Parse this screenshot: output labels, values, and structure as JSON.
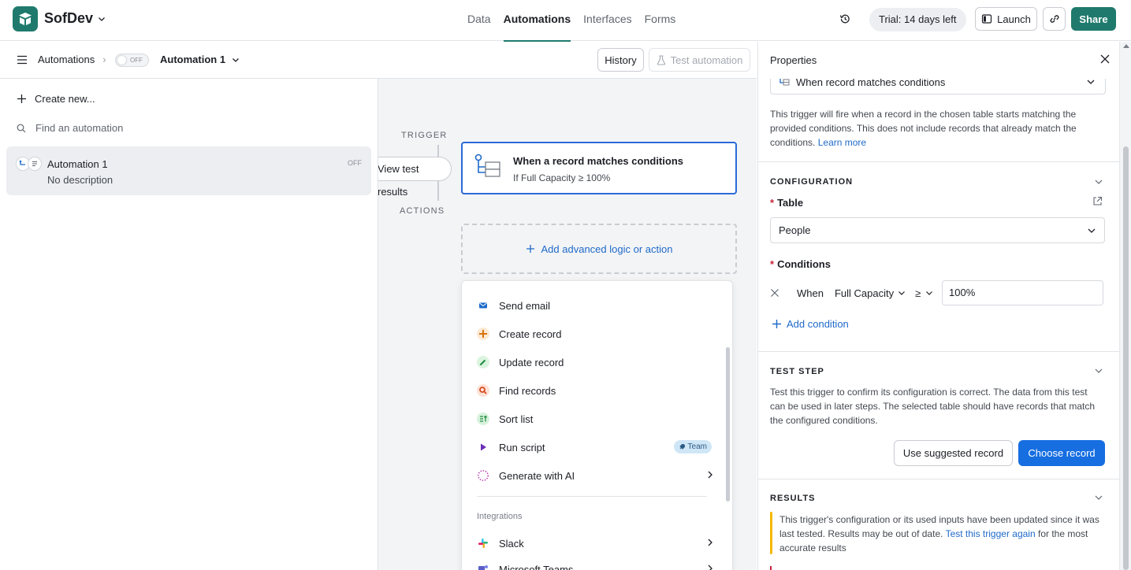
{
  "app": {
    "workspace_name": "SofDev",
    "tabs": [
      "Data",
      "Automations",
      "Interfaces",
      "Forms"
    ],
    "active_tab": "Automations",
    "trial_text": "Trial: 14 days left",
    "launch_label": "Launch",
    "share_label": "Share",
    "brand_color": "#1f7a6d"
  },
  "subbar": {
    "breadcrumb_root": "Automations",
    "toggle_text": "OFF",
    "automation_name": "Automation 1",
    "history_label": "History",
    "test_label": "Test automation"
  },
  "sidebar": {
    "create_label": "Create new...",
    "search_placeholder": "Find an automation",
    "items": [
      {
        "name": "Automation 1",
        "description": "No description",
        "status": "OFF"
      }
    ]
  },
  "canvas": {
    "trigger_label": "TRIGGER",
    "actions_label": "ACTIONS",
    "view_results_label": "View test results",
    "trigger_card": {
      "title": "When a record matches conditions",
      "subtitle": "If Full Capacity ≥ 100%"
    },
    "add_action_label": "Add advanced logic or action",
    "menu": {
      "items": [
        {
          "label": "Send email",
          "icon": "envelope-icon",
          "color": "#1f6ac9"
        },
        {
          "label": "Create record",
          "icon": "plus-icon",
          "color": "#d9730d"
        },
        {
          "label": "Update record",
          "icon": "pencil-icon",
          "color": "#1e8a3e"
        },
        {
          "label": "Find records",
          "icon": "magnifier-icon",
          "color": "#d94a1e"
        },
        {
          "label": "Sort list",
          "icon": "sort-icon",
          "color": "#1e8a3e"
        },
        {
          "label": "Run script",
          "icon": "play-icon",
          "color": "#6b2fb8",
          "badge": "Team"
        },
        {
          "label": "Generate with AI",
          "icon": "sparkle-icon",
          "color": "#b52fb0"
        }
      ],
      "integrations_header": "Integrations",
      "integrations": [
        {
          "label": "Slack",
          "icon": "slack-icon"
        },
        {
          "label": "Microsoft Teams",
          "icon": "teams-icon"
        }
      ]
    }
  },
  "properties": {
    "title": "Properties",
    "trigger_type": "When record matches conditions",
    "trigger_description": "This trigger will fire when a record in the chosen table starts matching the provided conditions. This does not include records that already match the conditions.",
    "learn_more": "Learn more",
    "configuration": {
      "header": "CONFIGURATION",
      "table_label": "Table",
      "table_value": "People",
      "conditions_label": "Conditions",
      "condition": {
        "when": "When",
        "field": "Full Capacity",
        "operator": "≥",
        "value": "100%"
      },
      "add_condition": "Add condition"
    },
    "test_step": {
      "header": "TEST STEP",
      "description": "Test this trigger to confirm its configuration is correct. The data from this test can be used in later steps. The selected table should have records that match the configured conditions.",
      "use_suggested": "Use suggested record",
      "choose_record": "Choose record"
    },
    "results": {
      "header": "RESULTS",
      "warning": "This trigger's configuration or its used inputs have been updated since it was last tested. Results may be out of date.",
      "retest_link": "Test this trigger again",
      "warning_tail": "for the most accurate results"
    }
  }
}
